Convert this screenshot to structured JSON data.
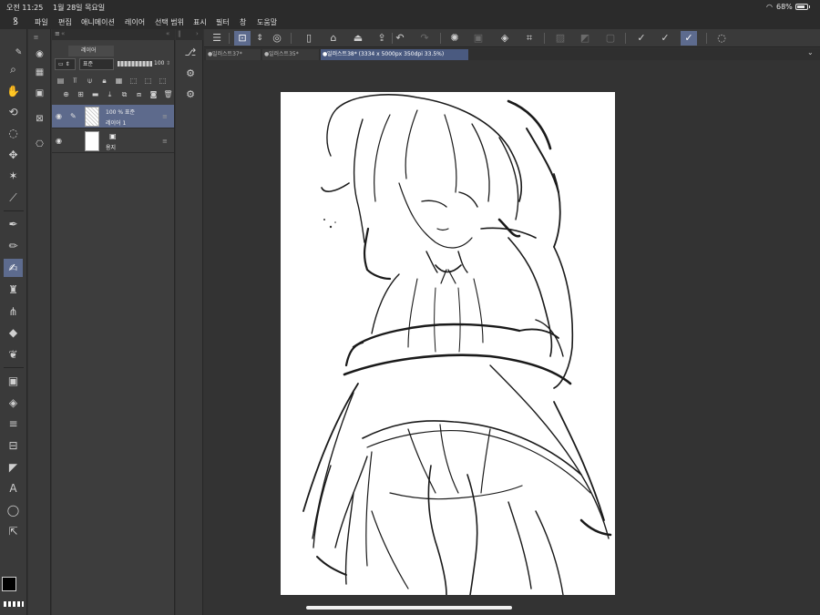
{
  "status_bar": {
    "time": "오전 11:25",
    "date": "1월 28일 목요일",
    "battery": "68%"
  },
  "menu_bar": {
    "items": [
      "파일",
      "편집",
      "애니메이션",
      "레이어",
      "선택 범위",
      "표시",
      "필터",
      "창",
      "도움말"
    ]
  },
  "layer_panel": {
    "tab_label": "레이어",
    "blend_mode": "표준",
    "opacity": "100",
    "layers": [
      {
        "name": "레이어 1",
        "info": "100 % 표준",
        "selected": true
      },
      {
        "name": "용지",
        "info": "",
        "selected": false
      }
    ]
  },
  "tabs": [
    {
      "label": "일러스트37*",
      "active": false
    },
    {
      "label": "일러스트35*",
      "active": false
    },
    {
      "label": "일러스트38* (3334 x 5000px 350dpi 33.5%)",
      "active": true
    }
  ],
  "colors": {
    "accent": "#5d6b8e",
    "main_color": "#000000",
    "sub_color": "#2d4a7a",
    "canvas_bg": "#333333",
    "paper": "#ffffff"
  },
  "icons": {
    "tools": [
      "pen-nib-icon",
      "zoom-icon",
      "hand-icon",
      "rotate-icon",
      "lasso-icon",
      "move-icon",
      "magic-wand-icon",
      "eyedropper-icon",
      "pen-icon",
      "pencil-icon",
      "brush-icon",
      "airbrush-icon",
      "decoration-icon",
      "eraser-icon",
      "blend-icon",
      "gradient-icon",
      "fill-icon",
      "figure-icon",
      "frame-icon",
      "ruler-icon",
      "text-icon",
      "balloon-icon",
      "correct-line-icon"
    ]
  }
}
